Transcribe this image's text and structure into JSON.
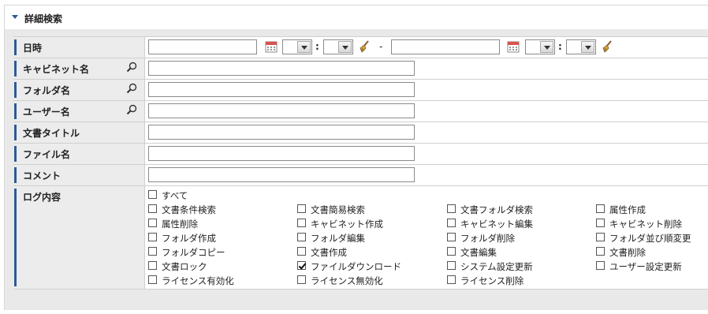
{
  "panel": {
    "title": "詳細検索"
  },
  "fields": {
    "datetime": {
      "label": "日時",
      "separator": ":",
      "range_dash": "-"
    },
    "cabinet": {
      "label": "キャビネット名",
      "value": ""
    },
    "folder": {
      "label": "フォルダ名",
      "value": ""
    },
    "user": {
      "label": "ユーザー名",
      "value": ""
    },
    "doc_title": {
      "label": "文書タイトル",
      "value": ""
    },
    "file_name": {
      "label": "ファイル名",
      "value": ""
    },
    "comment": {
      "label": "コメント",
      "value": ""
    },
    "log": {
      "label": "ログ内容",
      "all_label": "すべて",
      "all_checked": false,
      "options": [
        [
          {
            "label": "文書条件検索",
            "checked": false
          },
          {
            "label": "文書簡易検索",
            "checked": false
          },
          {
            "label": "文書フォルダ検索",
            "checked": false
          },
          {
            "label": "属性作成",
            "checked": false
          }
        ],
        [
          {
            "label": "属性削除",
            "checked": false
          },
          {
            "label": "キャビネット作成",
            "checked": false
          },
          {
            "label": "キャビネット編集",
            "checked": false
          },
          {
            "label": "キャビネット削除",
            "checked": false
          }
        ],
        [
          {
            "label": "フォルダ作成",
            "checked": false
          },
          {
            "label": "フォルダ編集",
            "checked": false
          },
          {
            "label": "フォルダ削除",
            "checked": false
          },
          {
            "label": "フォルダ並び順変更",
            "checked": false
          }
        ],
        [
          {
            "label": "フォルダコピー",
            "checked": false
          },
          {
            "label": "文書作成",
            "checked": false
          },
          {
            "label": "文書編集",
            "checked": false
          },
          {
            "label": "文書削除",
            "checked": false
          }
        ],
        [
          {
            "label": "文書ロック",
            "checked": false
          },
          {
            "label": "ファイルダウンロード",
            "checked": true
          },
          {
            "label": "システム設定更新",
            "checked": false
          },
          {
            "label": "ユーザー設定更新",
            "checked": false
          }
        ],
        [
          {
            "label": "ライセンス有効化",
            "checked": false
          },
          {
            "label": "ライセンス無効化",
            "checked": false
          },
          {
            "label": "ライセンス削除",
            "checked": false
          }
        ]
      ]
    }
  },
  "colors": {
    "accent": "#2c5a95",
    "label_bg": "#ececec",
    "body_bg": "#e9e9e9"
  },
  "icons": {
    "collapse": "triangle-down-icon",
    "search": "magnifier-icon",
    "calendar": "calendar-icon",
    "clear": "broom-icon"
  }
}
